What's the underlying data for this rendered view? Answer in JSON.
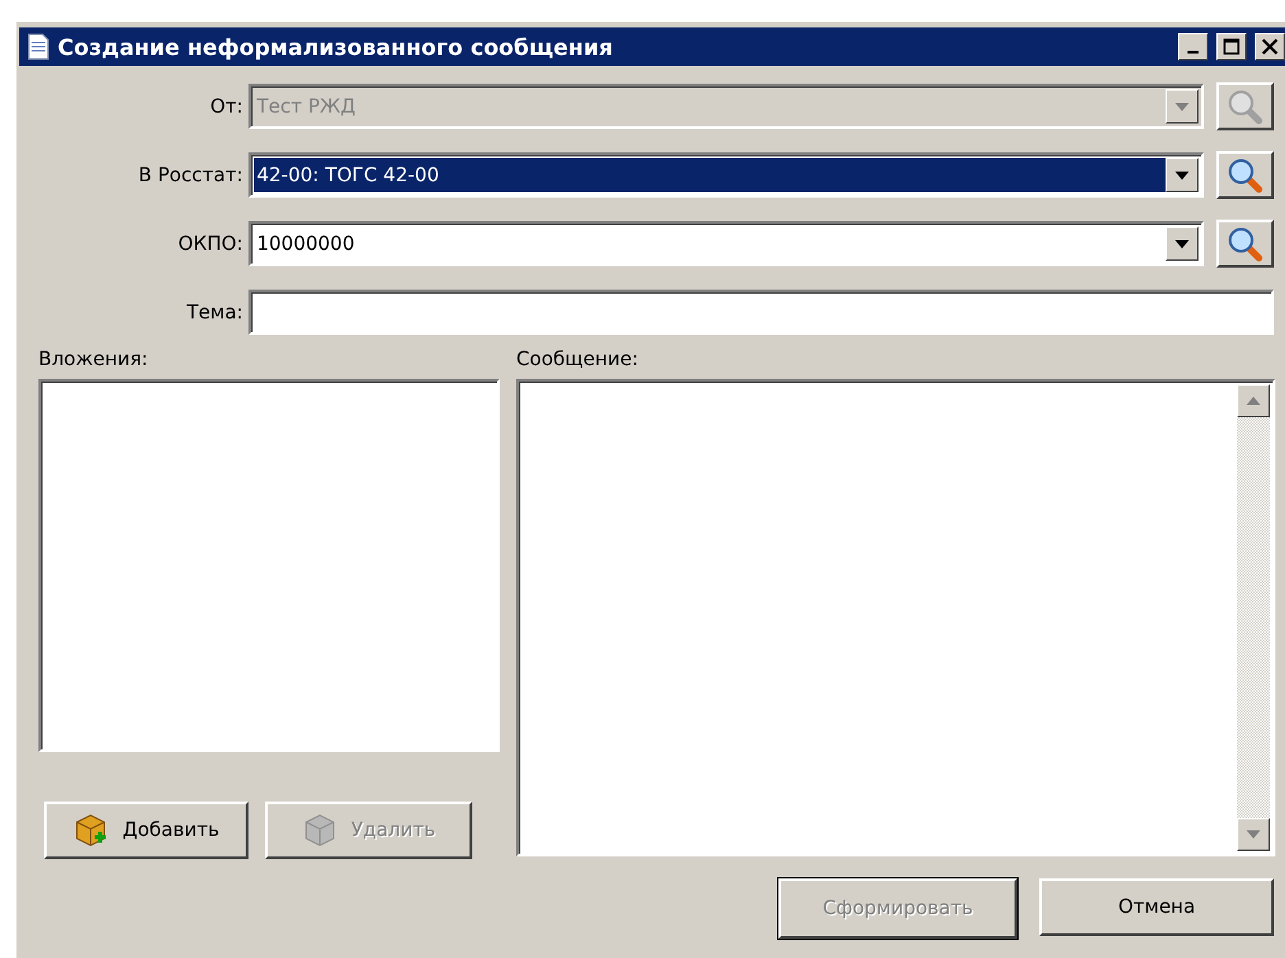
{
  "window": {
    "title": "Создание неформализованного сообщения"
  },
  "fields": [
    {
      "kind": "combo",
      "label": "От:",
      "value": "Тест РЖД",
      "disabled": true,
      "highlighted": false
    },
    {
      "kind": "combo",
      "label": "В Росстат:",
      "value": "42-00: ТОГС 42-00",
      "disabled": false,
      "highlighted": true
    },
    {
      "kind": "combo",
      "label": "ОКПО:",
      "value": "10000000",
      "disabled": false,
      "highlighted": false
    },
    {
      "kind": "text",
      "label": "Тема:",
      "disabled": false,
      "highlighted": false
    }
  ],
  "attachments": {
    "label": "Вложения:",
    "buttons": [
      {
        "label": "Добавить",
        "disabled": false
      },
      {
        "label": "Удалить",
        "disabled": true
      }
    ]
  },
  "message": {
    "label": "Сообщение:"
  },
  "buttons": [
    {
      "label": "Сформировать",
      "disabled": true,
      "default": true
    },
    {
      "label": "Отмена",
      "disabled": false,
      "default": false
    }
  ]
}
